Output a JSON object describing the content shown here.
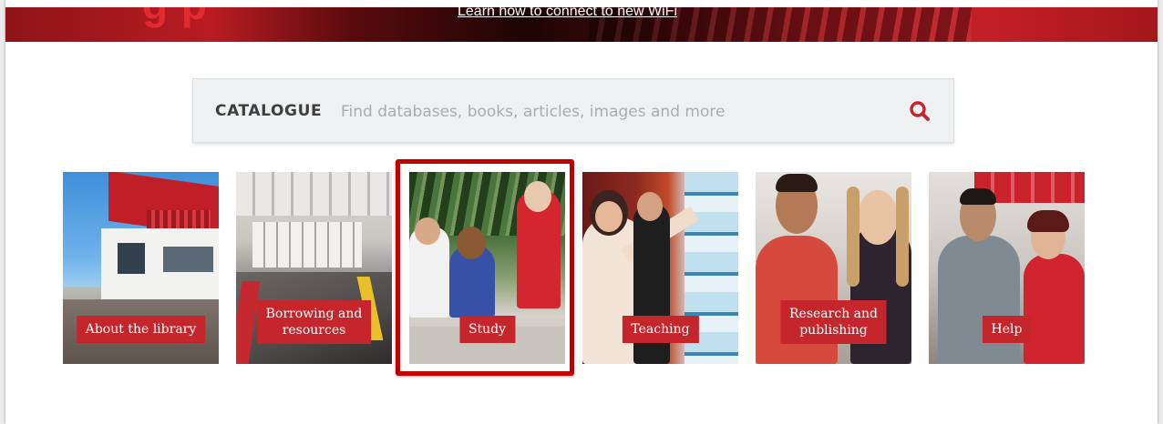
{
  "hero": {
    "title_fragment": "g  p",
    "wifi_link": "Learn how to connect to new WiFi"
  },
  "search": {
    "label": "CATALOGUE",
    "placeholder": "Find databases, books, articles, images and more",
    "button_icon": "search-icon",
    "icon_color": "#c4262c"
  },
  "tiles": [
    {
      "label": "About the library"
    },
    {
      "label": "Borrowing and\nresources"
    },
    {
      "label": "Study"
    },
    {
      "label": "Teaching"
    },
    {
      "label": "Research and\npublishing"
    },
    {
      "label": "Help"
    }
  ],
  "colors": {
    "brand_red": "#c4262c",
    "highlight_red": "#c00000"
  }
}
